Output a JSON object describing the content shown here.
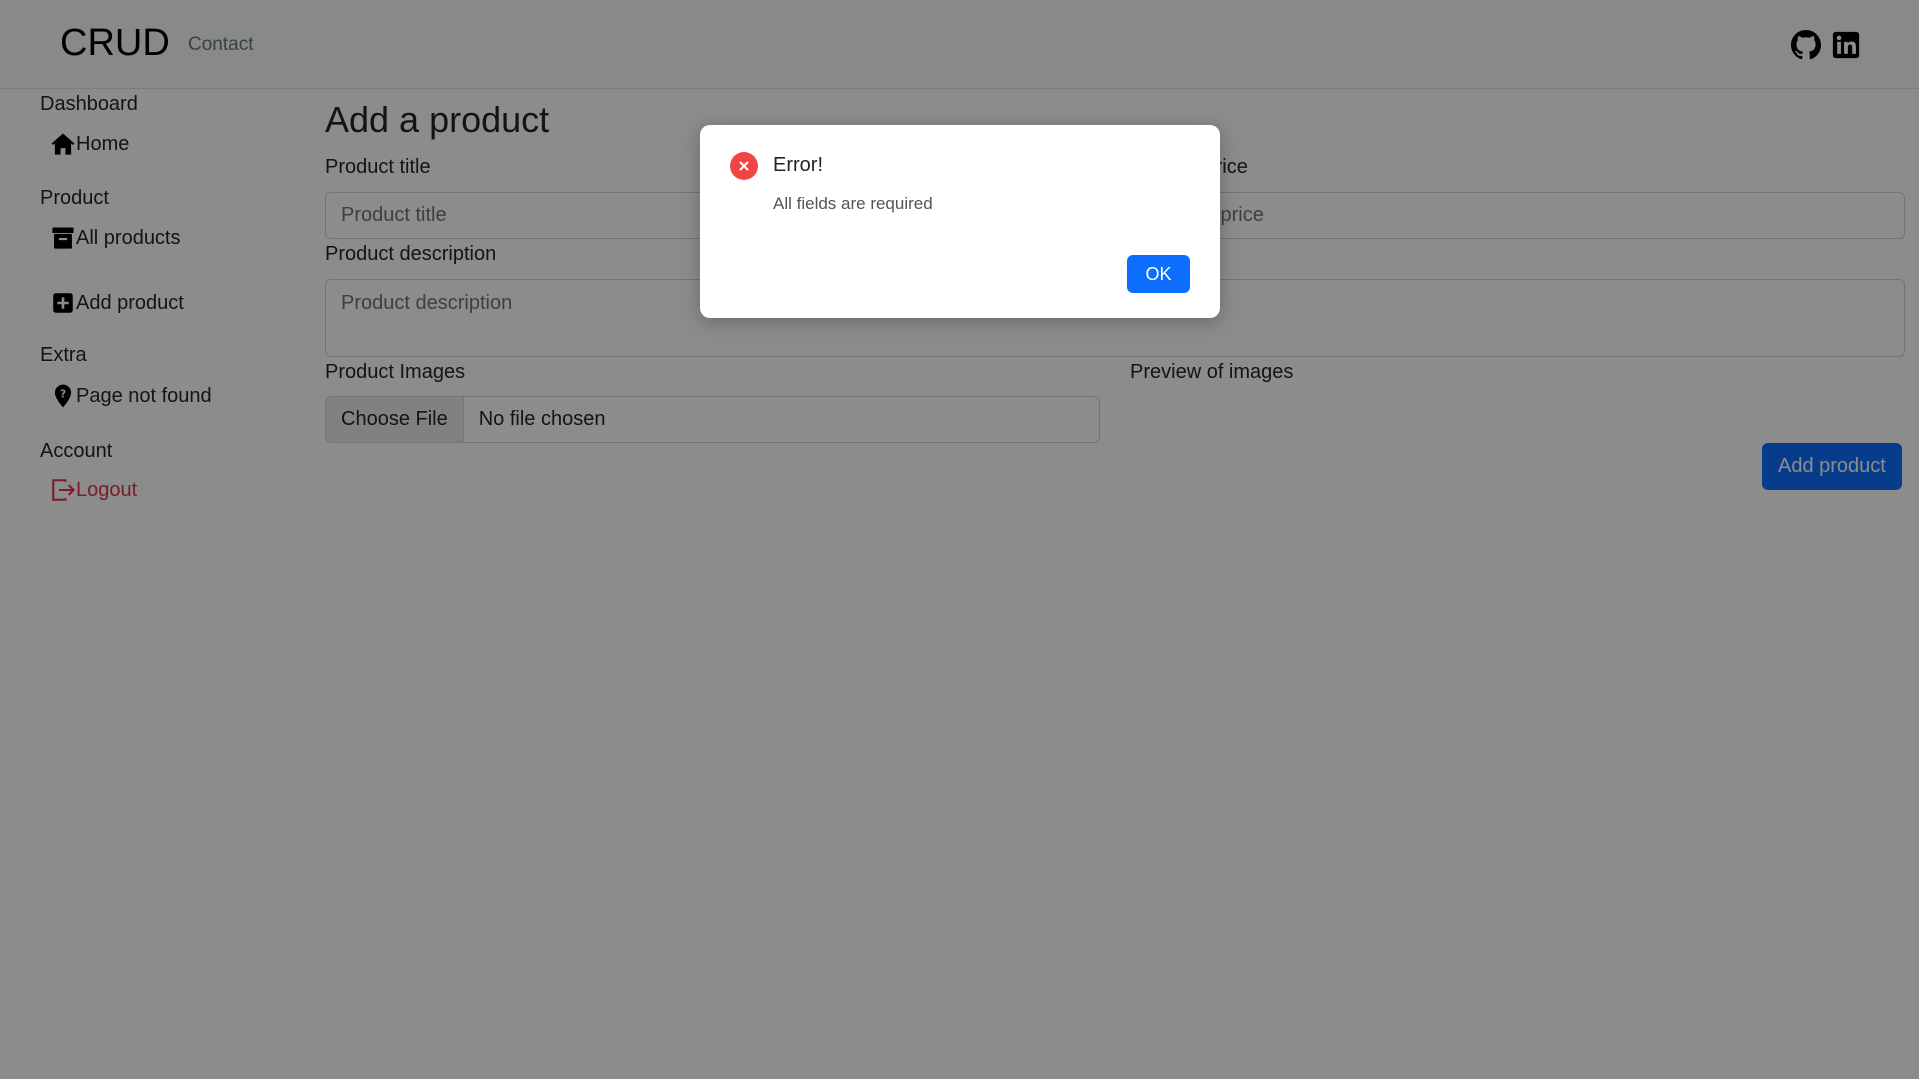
{
  "navbar": {
    "brand": "CRUD",
    "contact": "Contact",
    "icons": [
      "github-icon",
      "linkedin-icon"
    ]
  },
  "sidebar": {
    "sections": [
      {
        "heading": "Dashboard",
        "items": [
          {
            "label": "Home",
            "icon": "home-icon"
          }
        ]
      },
      {
        "heading": "Product",
        "items": [
          {
            "label": "All products",
            "icon": "archive-icon"
          },
          {
            "label": "Add product",
            "icon": "plus-square-icon"
          }
        ]
      },
      {
        "heading": "Extra",
        "items": [
          {
            "label": "Page not found",
            "icon": "question-pin-icon"
          }
        ]
      },
      {
        "heading": "Account",
        "items": [
          {
            "label": "Logout",
            "icon": "logout-icon"
          }
        ]
      }
    ]
  },
  "form": {
    "title": "Add a product",
    "product_title_label": "Product title",
    "product_title_placeholder": "Product title",
    "price_label": "Product price",
    "price_placeholder": "Product price",
    "description_label": "Product description",
    "description_placeholder": "Product description",
    "images_label": "Product Images",
    "choose_file": "Choose File",
    "no_file": "No file chosen",
    "preview_label": "Preview of images",
    "submit": "Add product"
  },
  "modal": {
    "title": "Error!",
    "message": "All fields are required",
    "ok": "OK",
    "icon": "error-icon"
  },
  "colors": {
    "primary": "#0d6efd",
    "danger": "#dc3545",
    "error_icon": "#f14545"
  }
}
